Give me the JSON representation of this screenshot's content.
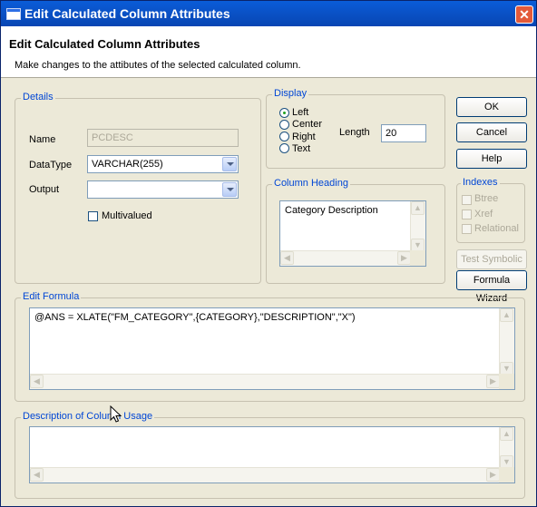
{
  "window": {
    "title": "Edit Calculated Column Attributes",
    "close_glyph": "✕"
  },
  "header": {
    "title": "Edit Calculated Column Attributes",
    "subtitle": "Make changes to the attibutes of the selected calculated column."
  },
  "details": {
    "legend": "Details",
    "name_label": "Name",
    "name_value": "PCDESC",
    "datatype_label": "DataType",
    "datatype_value": "VARCHAR(255)",
    "output_label": "Output",
    "output_value": "",
    "multivalued_label": "Multivalued",
    "multivalued_checked": false
  },
  "display": {
    "legend": "Display",
    "options": [
      "Left",
      "Center",
      "Right",
      "Text"
    ],
    "selected": "Left",
    "length_label": "Length",
    "length_value": "20"
  },
  "column_heading": {
    "legend": "Column Heading",
    "value": "Category Description"
  },
  "buttons": {
    "ok": "OK",
    "cancel": "Cancel",
    "help": "Help",
    "test_symbolic": "Test Symbolic",
    "formula_wizard": "Formula Wizard"
  },
  "indexes": {
    "legend": "Indexes",
    "items": [
      "Btree",
      "Xref",
      "Relational"
    ]
  },
  "edit_formula": {
    "legend": "Edit Formula",
    "value": "@ANS = XLATE(\"FM_CATEGORY\",{CATEGORY},\"DESCRIPTION\",\"X\")"
  },
  "description": {
    "legend": "Description of Column Usage",
    "value": ""
  },
  "colors": {
    "title_bar": "#0a53c9",
    "dialog_bg": "#ece9d8",
    "legend_text": "#0046d5",
    "close_button": "#e35a3a"
  }
}
